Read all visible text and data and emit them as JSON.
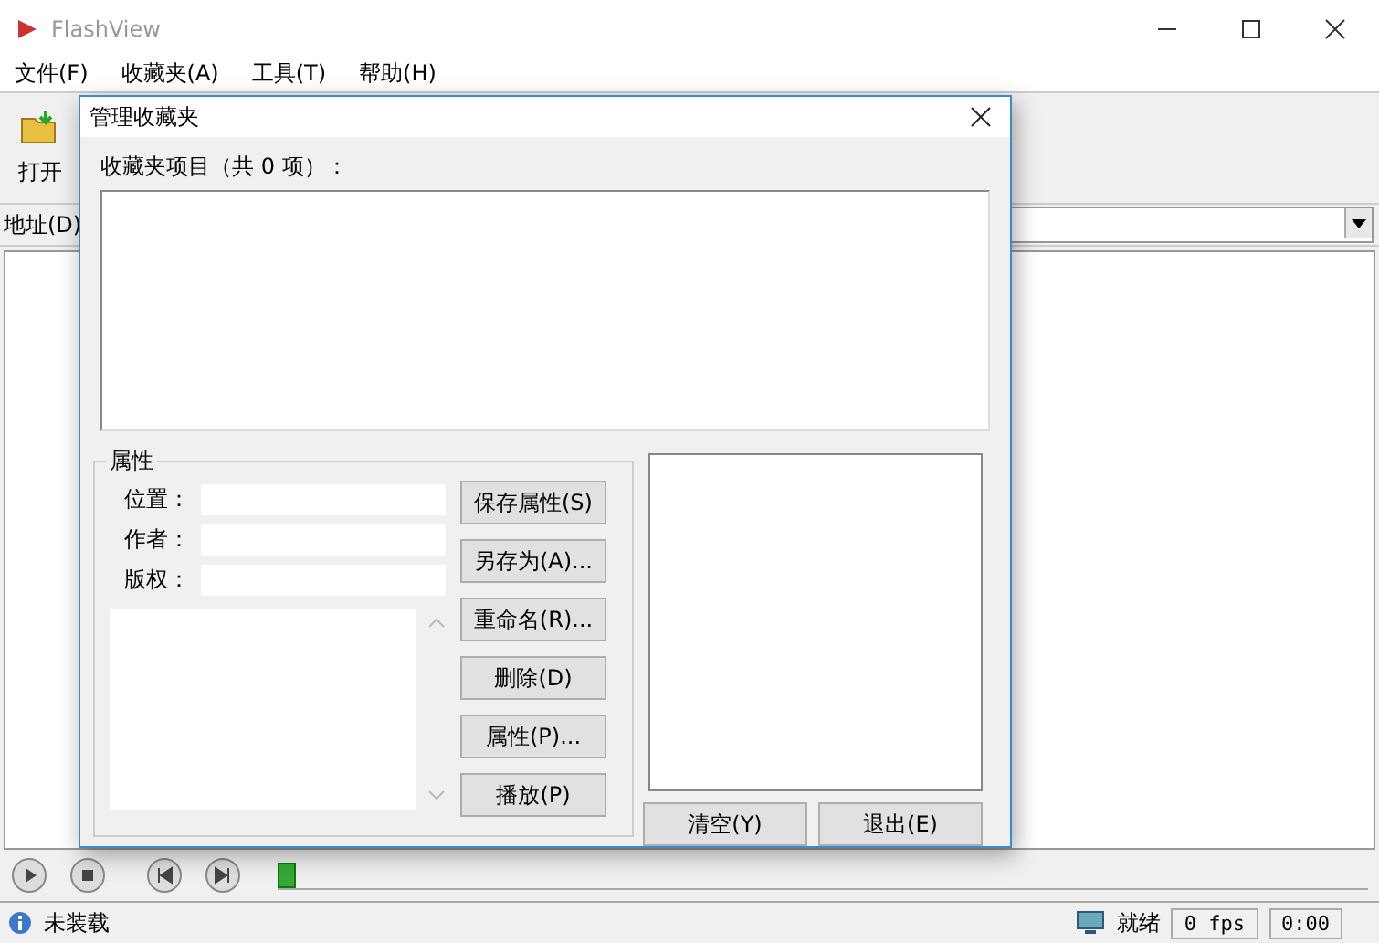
{
  "window": {
    "title": "FlashView"
  },
  "menu": [
    "文件(F)",
    "收藏夹(A)",
    "工具(T)",
    "帮助(H)"
  ],
  "toolbar": [
    {
      "label": "打开"
    }
  ],
  "address": {
    "label": "地址(D)"
  },
  "player": {
    "level": 0
  },
  "status_bar": {
    "message": "未装载",
    "state": "就绪",
    "fps": "0 fps",
    "time": "0:00"
  },
  "dialog": {
    "title": "管理收藏夹",
    "list_label": "收藏夹项目（共 0 项）：",
    "group_title": "属性",
    "fields": [
      {
        "label": "位置："
      },
      {
        "label": "作者："
      },
      {
        "label": "版权："
      }
    ],
    "buttons": [
      "保存属性(S)",
      "另存为(A)...",
      "重命名(R)...",
      "删除(D)",
      "属性(P)...",
      "播放(P)"
    ],
    "bottom_buttons": [
      "清空(Y)",
      "退出(E)"
    ]
  }
}
